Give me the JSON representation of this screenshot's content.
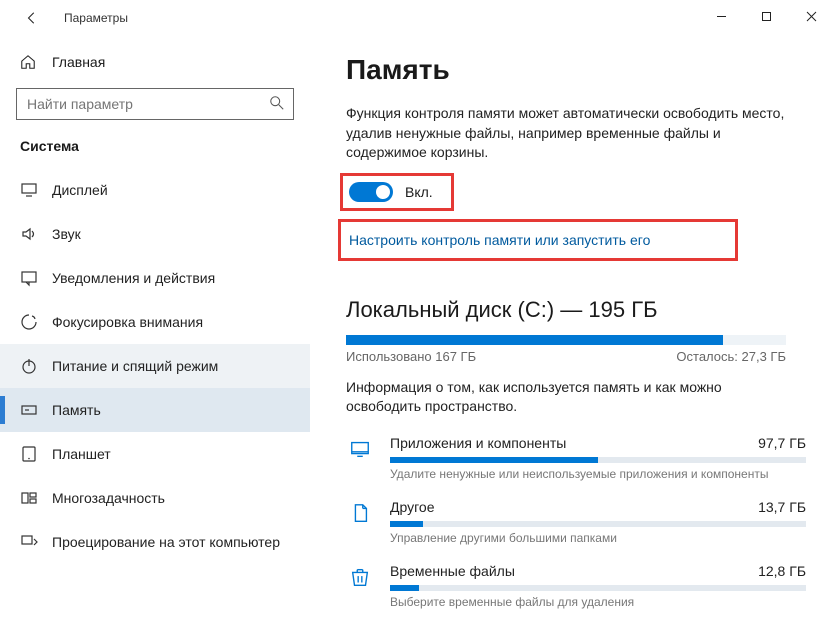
{
  "window": {
    "title": "Параметры"
  },
  "sidebar": {
    "home_label": "Главная",
    "search_placeholder": "Найти параметр",
    "section_title": "Система",
    "items": [
      {
        "label": "Дисплей",
        "icon": "display"
      },
      {
        "label": "Звук",
        "icon": "sound"
      },
      {
        "label": "Уведомления и действия",
        "icon": "notifications"
      },
      {
        "label": "Фокусировка внимания",
        "icon": "focus"
      },
      {
        "label": "Питание и спящий режим",
        "icon": "power"
      },
      {
        "label": "Память",
        "icon": "storage"
      },
      {
        "label": "Планшет",
        "icon": "tablet"
      },
      {
        "label": "Многозадачность",
        "icon": "multitask"
      },
      {
        "label": "Проецирование на этот компьютер",
        "icon": "project"
      }
    ]
  },
  "content": {
    "title": "Память",
    "description": "Функция контроля памяти может автоматически освободить место, удалив ненужные файлы, например временные файлы и содержимое корзины.",
    "toggle_label": "Вкл.",
    "config_link": "Настроить контроль памяти или запустить его",
    "disk_title": "Локальный диск (C:) — 195 ГБ",
    "disk_used": "Использовано 167 ГБ",
    "disk_free": "Осталось: 27,3 ГБ",
    "disk_info": "Информация о том, как используется память и как можно освободить пространство.",
    "categories": [
      {
        "name": "Приложения и компоненты",
        "size": "97,7 ГБ",
        "hint": "Удалите ненужные или неиспользуемые приложения и компоненты",
        "pct": 50
      },
      {
        "name": "Другое",
        "size": "13,7 ГБ",
        "hint": "Управление другими большими папками",
        "pct": 8
      },
      {
        "name": "Временные файлы",
        "size": "12,8 ГБ",
        "hint": "Выберите временные файлы для удаления",
        "pct": 7
      }
    ]
  }
}
